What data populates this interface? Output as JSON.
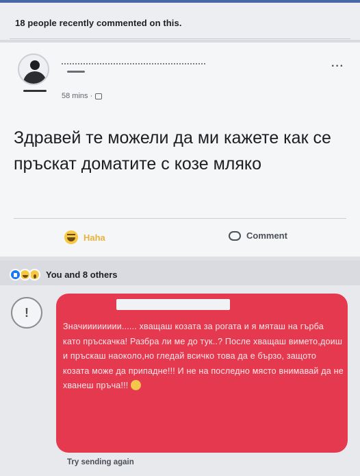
{
  "notice": {
    "text": "18 people recently commented on this."
  },
  "post": {
    "meta": {
      "time": "58 mins ·"
    },
    "more_label": "···",
    "text": "Здравей те можели да ми кажете как се пръскат доматите с козе мляко"
  },
  "actions": {
    "reaction_label": "Haha",
    "comment_label": "Comment"
  },
  "reactions_summary": {
    "text": "You and 8 others"
  },
  "comment": {
    "error_symbol": "!",
    "text": "Значииииииии...... хващаш козата за рогата и я мяташ на гърба като пръскачка! Разбра ли ме до тук..? После хващаш вимето,доиш и пръскаш наоколо,но гледай всичко това да е бързо, защото козата може да припадне!!! И не на последно място внимавай да не хванеш пръча!!!",
    "status": "Try sending again"
  },
  "colors": {
    "bubble": "#e5394f",
    "accent": "#4a67a8",
    "haha": "#f7c842",
    "like": "#1877f2"
  },
  "icons": [
    "avatar-icon",
    "globe-icon",
    "more-icon",
    "haha-emoji-icon",
    "comment-icon",
    "like-reaction-icon",
    "haha-reaction-icon",
    "wow-reaction-icon",
    "error-icon",
    "wink-emoji-icon"
  ]
}
